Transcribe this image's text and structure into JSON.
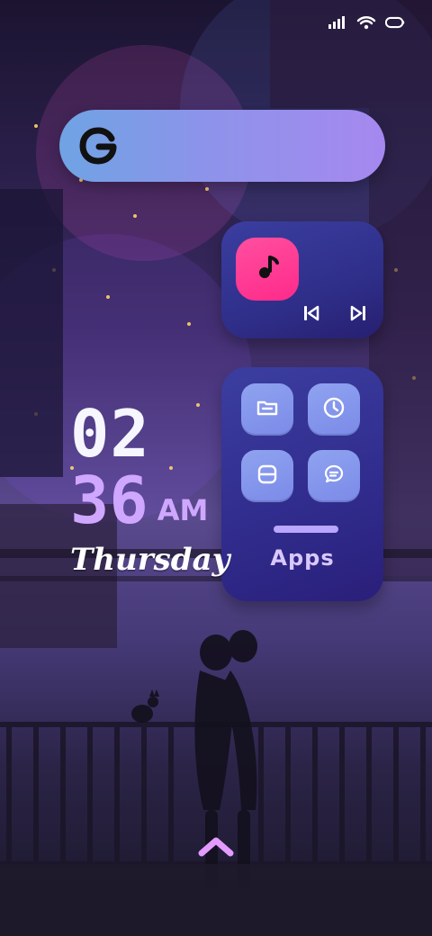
{
  "wallpaper": {
    "name": "neon-city-couple-wallpaper"
  },
  "status_bar": {
    "icons": [
      "signal-bars-icon",
      "wifi-hotspot-icon",
      "battery-icon"
    ]
  },
  "search_widget": {
    "logo_text": "G"
  },
  "music_widget": {
    "icon": "music-note-icon",
    "controls": [
      "previous-track-icon",
      "next-track-icon"
    ]
  },
  "apps_widget": {
    "apps": [
      "folder-icon",
      "clock-icon",
      "scanner-icon",
      "chat-bubble-icon"
    ],
    "label": "Apps"
  },
  "clock": {
    "hour": "02",
    "minute": "36",
    "ampm": "AM",
    "day": "Thursday"
  },
  "colors": {
    "accent_pink": "#ff2a8a",
    "widget_blue": "#2f2f8a",
    "minute_purple": "#cfa7ff",
    "search_gradient_start": "#6fa3e4",
    "search_gradient_end": "#a688ef"
  }
}
